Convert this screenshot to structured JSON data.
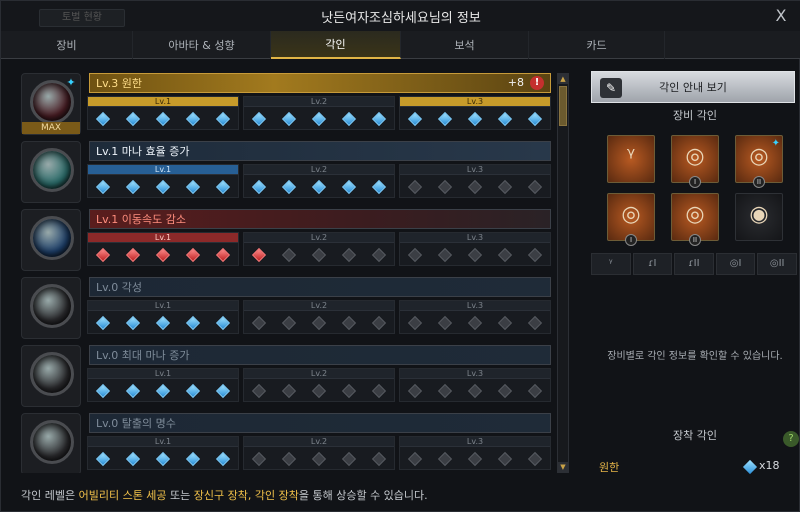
{
  "window": {
    "title": "낫든여자조심하세요님의 정보",
    "ghost_button": "토벌 현황",
    "close_glyph": "X"
  },
  "tabs": [
    {
      "label": "장비",
      "active": false
    },
    {
      "label": "아바타 & 성향",
      "active": false
    },
    {
      "label": "각인",
      "active": true
    },
    {
      "label": "보석",
      "active": false
    },
    {
      "label": "카드",
      "active": false
    }
  ],
  "engravings": [
    {
      "title": "Lv.3 원한",
      "style": "gold",
      "orb": "#4a1d24",
      "max_label": "MAX",
      "plus": "+8",
      "alert": "!",
      "levels": [
        {
          "label": "Lv.1",
          "state": "on"
        },
        {
          "label": "Lv.2",
          "state": "off"
        },
        {
          "label": "Lv.3",
          "state": "on"
        }
      ],
      "gems": [
        "b",
        "b",
        "b",
        "b",
        "b",
        "b",
        "b",
        "b",
        "b",
        "b",
        "b",
        "b",
        "b",
        "b",
        "b"
      ]
    },
    {
      "title": "Lv.1 마나 효율 증가",
      "style": "blue",
      "orb": "#2a6c6a",
      "levels": [
        {
          "label": "Lv.1",
          "state": "onb"
        },
        {
          "label": "Lv.2",
          "state": "off"
        },
        {
          "label": "Lv.3",
          "state": "off"
        }
      ],
      "gems": [
        "b",
        "b",
        "b",
        "b",
        "b",
        "b",
        "b",
        "b",
        "b",
        "b",
        "x",
        "x",
        "x",
        "x",
        "x"
      ]
    },
    {
      "title": "Lv.1 이동속도 감소",
      "style": "red",
      "orb": "#1d3f6a",
      "levels": [
        {
          "label": "Lv.1",
          "state": "onr"
        },
        {
          "label": "Lv.2",
          "state": "off"
        },
        {
          "label": "Lv.3",
          "state": "off"
        }
      ],
      "gems": [
        "r",
        "r",
        "r",
        "r",
        "r",
        "r",
        "x",
        "x",
        "x",
        "x",
        "x",
        "x",
        "x",
        "x",
        "x"
      ]
    },
    {
      "title": "Lv.0 각성",
      "style": "dim",
      "orb": "#2d2d30",
      "levels": [
        {
          "label": "Lv.1",
          "state": "off"
        },
        {
          "label": "Lv.2",
          "state": "off"
        },
        {
          "label": "Lv.3",
          "state": "off"
        }
      ],
      "gems": [
        "b",
        "b",
        "b",
        "b",
        "b",
        "x",
        "x",
        "x",
        "x",
        "x",
        "x",
        "x",
        "x",
        "x",
        "x"
      ]
    },
    {
      "title": "Lv.0 최대 마나 증가",
      "style": "dim",
      "orb": "#2d2d30",
      "levels": [
        {
          "label": "Lv.1",
          "state": "off"
        },
        {
          "label": "Lv.2",
          "state": "off"
        },
        {
          "label": "Lv.3",
          "state": "off"
        }
      ],
      "gems": [
        "b",
        "b",
        "b",
        "b",
        "b",
        "x",
        "x",
        "x",
        "x",
        "x",
        "x",
        "x",
        "x",
        "x",
        "x"
      ]
    },
    {
      "title": "Lv.0 탈출의 명수",
      "style": "dim",
      "orb": "#2d2d30",
      "levels": [
        {
          "label": "Lv.1",
          "state": "off"
        },
        {
          "label": "Lv.2",
          "state": "off"
        },
        {
          "label": "Lv.3",
          "state": "off"
        }
      ],
      "gems": [
        "b",
        "b",
        "b",
        "b",
        "b",
        "x",
        "x",
        "x",
        "x",
        "x",
        "x",
        "x",
        "x",
        "x",
        "x"
      ]
    }
  ],
  "footer": {
    "prefix": "각인 레벨은 ",
    "hl1": "어빌리티 스톤 세공",
    "mid": " 또는 ",
    "hl2": "장신구 장착, 각인 장착",
    "suffix": "을 통해 상승할 수 있습니다."
  },
  "side": {
    "guide_label": "각인 안내 보기",
    "equip_title": "장비 각인",
    "hint": "장비별로 각인 정보를 확인할 수 있습니다.",
    "mount_title": "장착 각인",
    "mount_name": "원한",
    "mount_count": "x18",
    "help": "?",
    "slots": [
      {
        "glyph": "ᵞ",
        "num": "",
        "star": false
      },
      {
        "glyph": "◎",
        "num": "I",
        "star": false
      },
      {
        "glyph": "◎",
        "num": "II",
        "star": true
      },
      {
        "glyph": "◎",
        "num": "I",
        "star": false
      },
      {
        "glyph": "◎",
        "num": "II",
        "star": false
      },
      {
        "glyph": "◉",
        "num": "",
        "star": false,
        "empty": true
      }
    ],
    "filters": [
      "ᵞ",
      "ɾI",
      "ɾII",
      "◎I",
      "◎II"
    ]
  },
  "colors": {
    "accent": "#e2b646",
    "gem_blue": "#2a8fd9",
    "gem_red": "#c02222"
  }
}
